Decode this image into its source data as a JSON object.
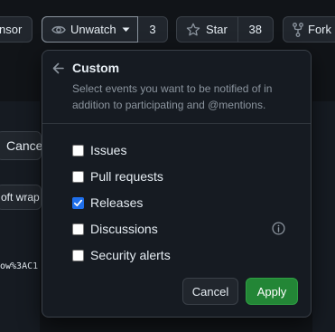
{
  "toolbar": {
    "sponsor_label": "nsor",
    "unwatch_label": "Unwatch",
    "watch_count": "3",
    "star_label": "Star",
    "star_count": "38",
    "fork_label": "Fork"
  },
  "background": {
    "cancel_label": "Cancel",
    "soft_wrap_label": "oft wrap",
    "url_fragment": "ow%3AC1"
  },
  "popover": {
    "title": "Custom",
    "description": "Select events you want to be notified of in addition to participating and @mentions.",
    "options": [
      {
        "label": "Issues",
        "checked": false
      },
      {
        "label": "Pull requests",
        "checked": false
      },
      {
        "label": "Releases",
        "checked": true
      },
      {
        "label": "Discussions",
        "checked": false
      },
      {
        "label": "Security alerts",
        "checked": false
      }
    ],
    "cancel_label": "Cancel",
    "apply_label": "Apply"
  },
  "colors": {
    "accent_checkbox": "#1f6feb",
    "apply_button": "#238636",
    "popover_bg": "#161b22"
  }
}
